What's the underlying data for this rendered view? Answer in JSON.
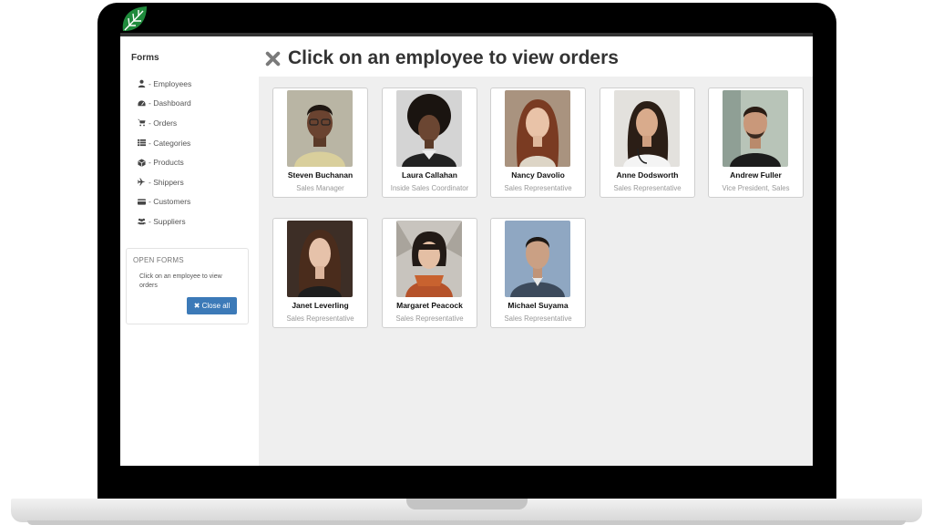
{
  "sidebar": {
    "title": "Forms",
    "items": [
      {
        "label": "- Employees",
        "icon": "user-icon"
      },
      {
        "label": "- Dashboard",
        "icon": "dashboard-icon"
      },
      {
        "label": "- Orders",
        "icon": "cart-icon"
      },
      {
        "label": "- Categories",
        "icon": "list-icon"
      },
      {
        "label": "- Products",
        "icon": "cube-icon"
      },
      {
        "label": "- Shippers",
        "icon": "plane-icon"
      },
      {
        "label": "- Customers",
        "icon": "card-icon"
      },
      {
        "label": "- Suppliers",
        "icon": "users-icon"
      }
    ]
  },
  "open_forms": {
    "header": "OPEN FORMS",
    "message": "Click on an employee to view orders",
    "close_all_label": "✖ Close all"
  },
  "main": {
    "title": "Click on an employee to view orders"
  },
  "employees": [
    {
      "name": "Steven Buchanan",
      "title": "Sales Manager"
    },
    {
      "name": "Laura Callahan",
      "title": "Inside Sales Coordinator"
    },
    {
      "name": "Nancy Davolio",
      "title": "Sales Representative"
    },
    {
      "name": "Anne Dodsworth",
      "title": "Sales Representative"
    },
    {
      "name": "Andrew Fuller",
      "title": "Vice President, Sales"
    },
    {
      "name": "Janet Leverling",
      "title": "Sales Representative"
    },
    {
      "name": "Margaret Peacock",
      "title": "Sales Representative"
    },
    {
      "name": "Michael Suyama",
      "title": "Sales Representative"
    }
  ],
  "colors": {
    "accent": "#3c7ab8",
    "logo_green": "#1f8a3c",
    "content_bg": "#efefef"
  }
}
